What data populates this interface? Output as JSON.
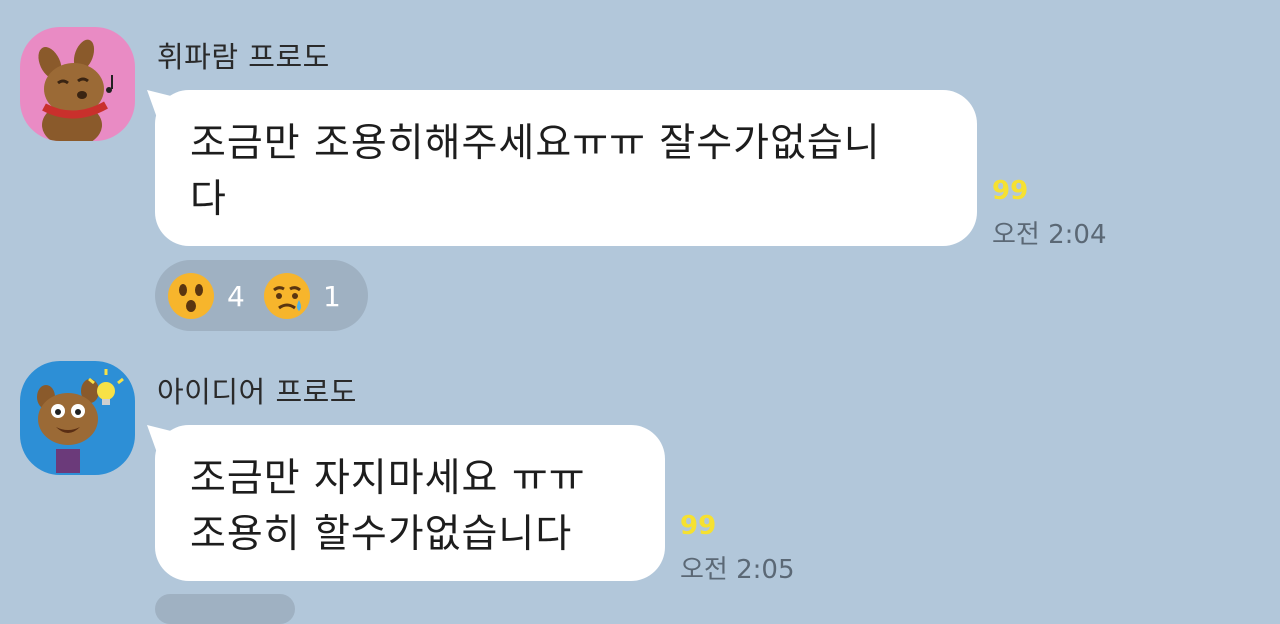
{
  "chat": {
    "messages": [
      {
        "sender": "휘파람 프로도",
        "avatar_icon": "frodo-whistling-icon",
        "lines": [
          "조금만 조용히해주세요ㅠㅠ 잘수가없습니",
          "다"
        ],
        "unread": "99",
        "time": "오전 2:04",
        "reactions": [
          {
            "emoji": "surprised-face-icon",
            "count": "4"
          },
          {
            "emoji": "sad-tear-face-icon",
            "count": "1"
          }
        ]
      },
      {
        "sender": "아이디어 프로도",
        "avatar_icon": "frodo-idea-lightbulb-icon",
        "lines": [
          "조금만 자지마세요 ㅠㅠ",
          "조용히 할수가없습니다"
        ],
        "unread": "99",
        "time": "오전 2:05"
      }
    ]
  },
  "colors": {
    "chat_background": "#b2c7da",
    "bubble": "#ffffff",
    "unread_count": "#f6e131",
    "reaction_pill": "#9fb1c2"
  }
}
